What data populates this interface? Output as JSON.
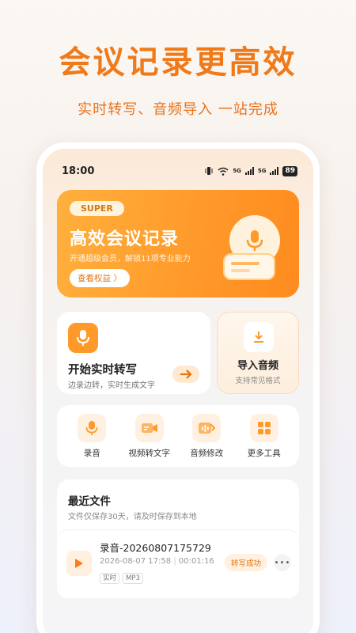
{
  "promo": {
    "headline": "会议记录更高效",
    "subline": "实时转写、音频导入  一站完成"
  },
  "status_bar": {
    "time": "18:00",
    "battery": "89",
    "signal1": "5G",
    "signal2": "5G"
  },
  "banner": {
    "tag": "SUPER",
    "title": "高效会议记录",
    "desc": "开通超级会员，解锁11项专业能力",
    "button": "查看权益 〉"
  },
  "realtime": {
    "title": "开始实时转写",
    "desc": "边录边转，实时生成文字"
  },
  "import_audio": {
    "title": "导入音频",
    "desc": "支持常见格式"
  },
  "tools": [
    {
      "label": "录音",
      "icon": "mic-icon"
    },
    {
      "label": "视频转文字",
      "icon": "video-icon"
    },
    {
      "label": "音频修改",
      "icon": "audio-edit-icon"
    },
    {
      "label": "更多工具",
      "icon": "grid-icon"
    }
  ],
  "recent": {
    "title": "最近文件",
    "desc": "文件仅保存30天，请及时保存到本地",
    "files": [
      {
        "name": "录音-20260807175729",
        "datetime": "2026-08-07 17:58",
        "duration": "00:01:16",
        "tags": [
          "实时",
          "MP3"
        ],
        "status": "转写成功"
      }
    ]
  },
  "colors": {
    "accent": "#ff9a2a",
    "headline": "#f07a1a"
  }
}
